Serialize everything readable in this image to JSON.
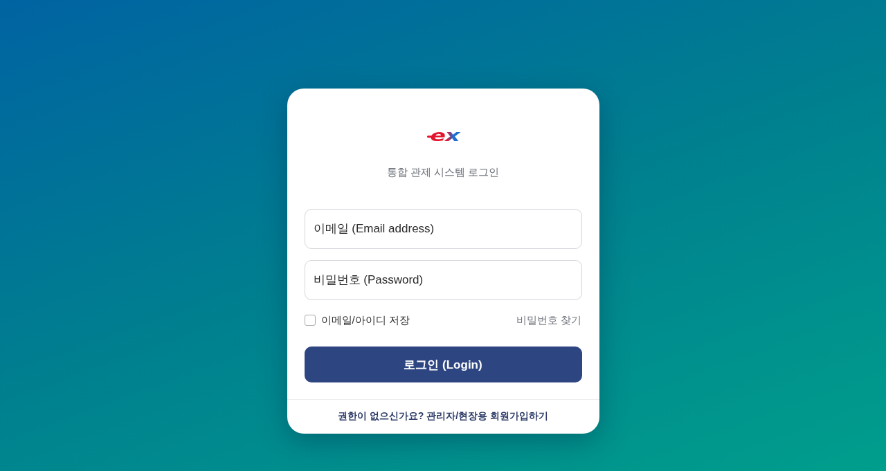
{
  "logo": {
    "text": "ex"
  },
  "subtitle": "통합 관제 시스템 로그인",
  "fields": [
    {
      "placeholder": "이메일 (Email address)"
    },
    {
      "placeholder": "비밀번호 (Password)"
    }
  ],
  "remember": {
    "label": "이메일/아이디 저장",
    "checked": false
  },
  "forgot_link": "비밀번호 찾기",
  "login_button": "로그인 (Login)",
  "signup_link": "권한이 없으신가요? 관리자/현장용 회원가입하기"
}
